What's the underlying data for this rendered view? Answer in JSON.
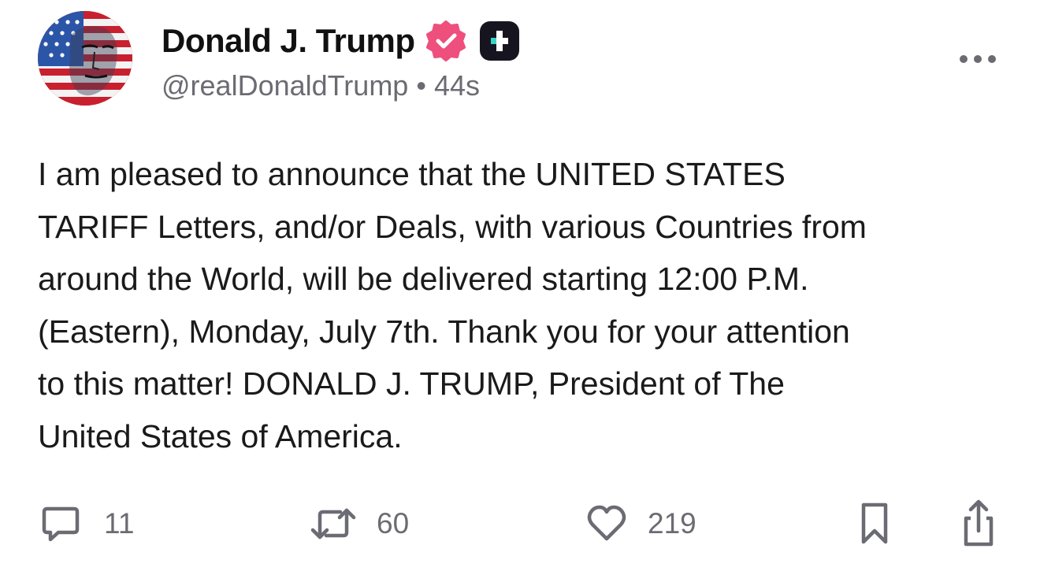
{
  "author": {
    "display_name": "Donald J. Trump",
    "handle": "@realDonaldTrump",
    "separator": "•",
    "timestamp": "44s",
    "verified_badge_color": "#ee4f7c",
    "truth_plus_badge_color": "#16151f"
  },
  "post": {
    "lines": [
      "I am pleased to announce that the UNITED STATES",
      "TARIFF Letters, and/or Deals, with various Countries from",
      "around the World, will be delivered starting 12:00 P.M.",
      "(Eastern), Monday, July 7th. Thank you for your attention",
      "to this matter! DONALD J. TRUMP, President of The",
      "United States of America."
    ]
  },
  "actions": {
    "reply": {
      "icon": "speech-bubble-icon",
      "count": "11"
    },
    "retruth": {
      "icon": "repost-arrows-icon",
      "count": "60"
    },
    "like": {
      "icon": "heart-icon",
      "count": "219"
    },
    "bookmark": {
      "icon": "bookmark-icon"
    },
    "share": {
      "icon": "share-icon"
    }
  },
  "more_menu": {
    "icon": "ellipsis-icon"
  },
  "colors": {
    "icon_gray": "#6b6b73",
    "text": "#1a1a1a"
  }
}
